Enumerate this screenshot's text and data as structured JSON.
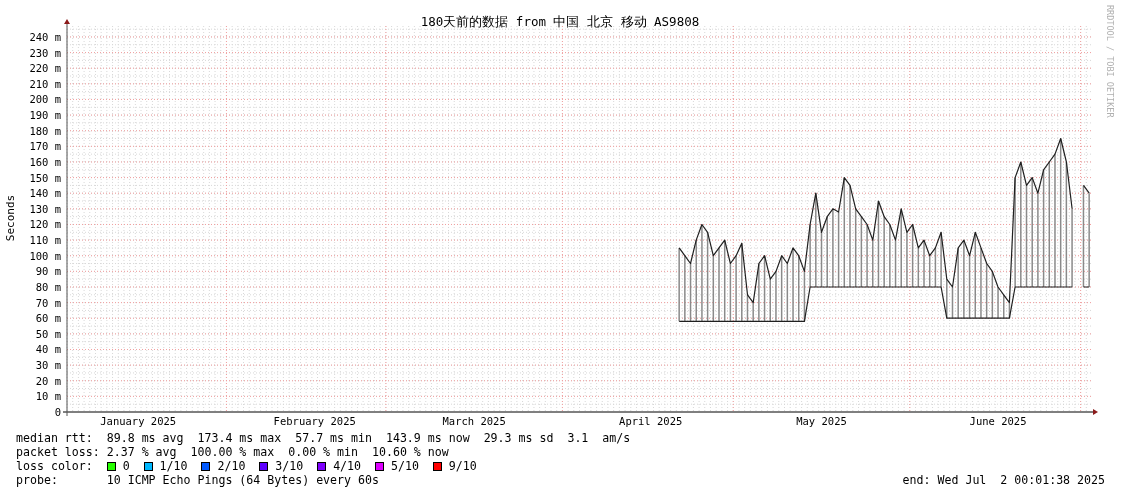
{
  "chart": {
    "side_text": "RRDTOOL / TOBI OETIKER",
    "chart_data": {
      "type": "line",
      "title": "180天前的数据 from 中国 北京 移动 AS9808",
      "ylabel": "Seconds",
      "grid": true,
      "ylim": [
        0,
        247
      ],
      "categories": [
        null,
        null,
        null,
        null,
        null,
        null,
        null,
        null,
        null,
        null,
        null,
        null,
        "January 2025",
        null,
        null,
        null,
        null,
        null,
        null,
        null,
        null,
        null,
        null,
        null,
        null,
        null,
        null,
        null,
        null,
        null,
        null,
        null,
        null,
        null,
        null,
        null,
        null,
        null,
        null,
        null,
        null,
        null,
        null,
        "February 2025",
        null,
        null,
        null,
        null,
        null,
        null,
        null,
        null,
        null,
        null,
        null,
        null,
        null,
        null,
        null,
        null,
        null,
        null,
        null,
        null,
        null,
        null,
        null,
        null,
        null,
        null,
        null,
        "March 2025",
        null,
        null,
        null,
        null,
        null,
        null,
        null,
        null,
        null,
        null,
        null,
        null,
        null,
        null,
        null,
        null,
        null,
        null,
        null,
        null,
        null,
        null,
        null,
        null,
        null,
        null,
        null,
        null,
        null,
        null,
        "April 2025",
        null,
        null,
        null,
        null,
        null,
        null,
        null,
        null,
        null,
        null,
        null,
        null,
        null,
        null,
        null,
        null,
        null,
        null,
        null,
        null,
        null,
        null,
        null,
        null,
        null,
        null,
        null,
        null,
        null,
        "May 2025",
        null,
        null,
        null,
        null,
        null,
        null,
        null,
        null,
        null,
        null,
        null,
        null,
        null,
        null,
        null,
        null,
        null,
        null,
        null,
        null,
        null,
        null,
        null,
        null,
        null,
        null,
        null,
        null,
        null,
        null,
        "June 2025",
        null,
        null,
        null,
        null,
        null,
        null,
        null,
        null,
        null,
        null,
        null,
        null,
        null,
        null,
        null,
        null
      ],
      "yticks": [
        0,
        {
          "value": 10,
          "label": "10 m"
        },
        {
          "value": 20,
          "label": "20 m"
        },
        {
          "value": 30,
          "label": "30 m"
        },
        {
          "value": 40,
          "label": "40 m"
        },
        {
          "value": 50,
          "label": "50 m"
        },
        {
          "value": 60,
          "label": "60 m"
        },
        {
          "value": 70,
          "label": "70 m"
        },
        {
          "value": 80,
          "label": "80 m"
        },
        {
          "value": 90,
          "label": "90 m"
        },
        {
          "value": 100,
          "label": "100 m"
        },
        {
          "value": 110,
          "label": "110 m"
        },
        {
          "value": 120,
          "label": "120 m"
        },
        {
          "value": 130,
          "label": "130 m"
        },
        {
          "value": 140,
          "label": "140 m"
        },
        {
          "value": 150,
          "label": "150 m"
        },
        {
          "value": 160,
          "label": "160 m"
        },
        {
          "value": 170,
          "label": "170 m"
        },
        {
          "value": 180,
          "label": "180 m"
        },
        {
          "value": 190,
          "label": "190 m"
        },
        {
          "value": 200,
          "label": "200 m"
        },
        {
          "value": 210,
          "label": "210 m"
        },
        {
          "value": 220,
          "label": "220 m"
        },
        {
          "value": 230,
          "label": "230 m"
        },
        {
          "value": 240,
          "label": "240 m"
        }
      ],
      "series": [
        {
          "color": "#202020",
          "values": [
            null,
            null,
            null,
            null,
            null,
            null,
            null,
            null,
            null,
            null,
            null,
            null,
            null,
            null,
            null,
            null,
            null,
            null,
            null,
            null,
            null,
            null,
            null,
            null,
            null,
            null,
            null,
            null,
            null,
            null,
            null,
            null,
            null,
            null,
            null,
            null,
            null,
            null,
            null,
            null,
            null,
            null,
            null,
            null,
            null,
            null,
            null,
            null,
            null,
            null,
            null,
            null,
            null,
            null,
            null,
            null,
            null,
            null,
            null,
            null,
            null,
            null,
            null,
            null,
            null,
            null,
            null,
            null,
            null,
            null,
            null,
            null,
            null,
            null,
            null,
            null,
            null,
            null,
            null,
            null,
            null,
            null,
            null,
            null,
            null,
            null,
            null,
            null,
            null,
            null,
            null,
            null,
            null,
            null,
            null,
            null,
            null,
            null,
            null,
            null,
            null,
            null,
            null,
            null,
            null,
            null,
            null,
            105,
            100,
            95,
            110,
            120,
            115,
            100,
            105,
            110,
            95,
            100,
            108,
            75,
            70,
            95,
            100,
            85,
            90,
            100,
            95,
            105,
            100,
            90,
            120,
            140,
            115,
            125,
            130,
            128,
            150,
            145,
            130,
            125,
            120,
            110,
            135,
            125,
            120,
            110,
            130,
            115,
            120,
            105,
            110,
            100,
            105,
            115,
            85,
            80,
            105,
            110,
            100,
            115,
            105,
            95,
            90,
            80,
            75,
            70,
            150,
            160,
            145,
            150,
            140,
            155,
            160,
            165,
            175,
            160,
            130,
            null,
            145,
            140
          ]
        },
        {
          "color": "#202020",
          "values": [
            null,
            null,
            null,
            null,
            null,
            null,
            null,
            null,
            null,
            null,
            null,
            null,
            null,
            null,
            null,
            null,
            null,
            null,
            null,
            null,
            null,
            null,
            null,
            null,
            null,
            null,
            null,
            null,
            null,
            null,
            null,
            null,
            null,
            null,
            null,
            null,
            null,
            null,
            null,
            null,
            null,
            null,
            null,
            null,
            null,
            null,
            null,
            null,
            null,
            null,
            null,
            null,
            null,
            null,
            null,
            null,
            null,
            null,
            null,
            null,
            null,
            null,
            null,
            null,
            null,
            null,
            null,
            null,
            null,
            null,
            null,
            null,
            null,
            null,
            null,
            null,
            null,
            null,
            null,
            null,
            null,
            null,
            null,
            null,
            null,
            null,
            null,
            null,
            null,
            null,
            null,
            null,
            null,
            null,
            null,
            null,
            null,
            null,
            null,
            null,
            null,
            null,
            null,
            null,
            null,
            null,
            null,
            58,
            58,
            58,
            58,
            58,
            58,
            58,
            58,
            58,
            58,
            58,
            58,
            58,
            58,
            58,
            58,
            58,
            58,
            58,
            58,
            58,
            58,
            58,
            80,
            80,
            80,
            80,
            80,
            80,
            80,
            80,
            80,
            80,
            80,
            80,
            80,
            80,
            80,
            80,
            80,
            80,
            80,
            80,
            80,
            80,
            80,
            80,
            60,
            60,
            60,
            60,
            60,
            60,
            60,
            60,
            60,
            60,
            60,
            60,
            80,
            80,
            80,
            80,
            80,
            80,
            80,
            80,
            80,
            80,
            80,
            null,
            80,
            80
          ]
        }
      ]
    }
  },
  "median_rtt": {
    "label": "median rtt:",
    "values": [
      "89.8 ms avg",
      "173.4 ms max",
      "57.7 ms min",
      "143.9 ms now",
      "29.3 ms sd",
      "3.1",
      "am/s"
    ]
  },
  "packet_loss": {
    "label": "packet loss:",
    "values": [
      "2.37 % avg",
      "100.00 % max",
      "0.00 % min",
      "10.60 % now"
    ]
  },
  "loss_color": {
    "label": "loss color:",
    "items": [
      {
        "label": "0",
        "color": "#26ff00"
      },
      {
        "label": "1/10",
        "color": "#00b8ff"
      },
      {
        "label": "2/10",
        "color": "#0059ff"
      },
      {
        "label": "3/10",
        "color": "#5e00ff"
      },
      {
        "label": "4/10",
        "color": "#7e00ff"
      },
      {
        "label": "5/10",
        "color": "#dd00ff"
      },
      {
        "label": "9/10",
        "color": "#ff0000"
      }
    ]
  },
  "probe": {
    "label": "probe:",
    "value": "10 ICMP Echo Pings (64 Bytes) every 60s"
  },
  "end": "end: Wed Jul  2 00:01:38 2025"
}
